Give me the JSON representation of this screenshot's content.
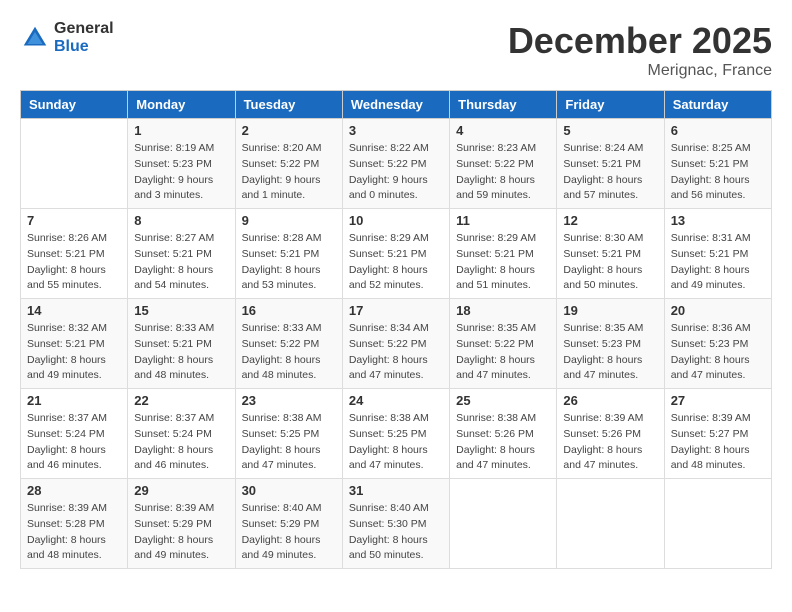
{
  "logo": {
    "general": "General",
    "blue": "Blue"
  },
  "title": "December 2025",
  "location": "Merignac, France",
  "headers": [
    "Sunday",
    "Monday",
    "Tuesday",
    "Wednesday",
    "Thursday",
    "Friday",
    "Saturday"
  ],
  "weeks": [
    [
      {
        "day": "",
        "detail": ""
      },
      {
        "day": "1",
        "detail": "Sunrise: 8:19 AM\nSunset: 5:23 PM\nDaylight: 9 hours\nand 3 minutes."
      },
      {
        "day": "2",
        "detail": "Sunrise: 8:20 AM\nSunset: 5:22 PM\nDaylight: 9 hours\nand 1 minute."
      },
      {
        "day": "3",
        "detail": "Sunrise: 8:22 AM\nSunset: 5:22 PM\nDaylight: 9 hours\nand 0 minutes."
      },
      {
        "day": "4",
        "detail": "Sunrise: 8:23 AM\nSunset: 5:22 PM\nDaylight: 8 hours\nand 59 minutes."
      },
      {
        "day": "5",
        "detail": "Sunrise: 8:24 AM\nSunset: 5:21 PM\nDaylight: 8 hours\nand 57 minutes."
      },
      {
        "day": "6",
        "detail": "Sunrise: 8:25 AM\nSunset: 5:21 PM\nDaylight: 8 hours\nand 56 minutes."
      }
    ],
    [
      {
        "day": "7",
        "detail": "Sunrise: 8:26 AM\nSunset: 5:21 PM\nDaylight: 8 hours\nand 55 minutes."
      },
      {
        "day": "8",
        "detail": "Sunrise: 8:27 AM\nSunset: 5:21 PM\nDaylight: 8 hours\nand 54 minutes."
      },
      {
        "day": "9",
        "detail": "Sunrise: 8:28 AM\nSunset: 5:21 PM\nDaylight: 8 hours\nand 53 minutes."
      },
      {
        "day": "10",
        "detail": "Sunrise: 8:29 AM\nSunset: 5:21 PM\nDaylight: 8 hours\nand 52 minutes."
      },
      {
        "day": "11",
        "detail": "Sunrise: 8:29 AM\nSunset: 5:21 PM\nDaylight: 8 hours\nand 51 minutes."
      },
      {
        "day": "12",
        "detail": "Sunrise: 8:30 AM\nSunset: 5:21 PM\nDaylight: 8 hours\nand 50 minutes."
      },
      {
        "day": "13",
        "detail": "Sunrise: 8:31 AM\nSunset: 5:21 PM\nDaylight: 8 hours\nand 49 minutes."
      }
    ],
    [
      {
        "day": "14",
        "detail": "Sunrise: 8:32 AM\nSunset: 5:21 PM\nDaylight: 8 hours\nand 49 minutes."
      },
      {
        "day": "15",
        "detail": "Sunrise: 8:33 AM\nSunset: 5:21 PM\nDaylight: 8 hours\nand 48 minutes."
      },
      {
        "day": "16",
        "detail": "Sunrise: 8:33 AM\nSunset: 5:22 PM\nDaylight: 8 hours\nand 48 minutes."
      },
      {
        "day": "17",
        "detail": "Sunrise: 8:34 AM\nSunset: 5:22 PM\nDaylight: 8 hours\nand 47 minutes."
      },
      {
        "day": "18",
        "detail": "Sunrise: 8:35 AM\nSunset: 5:22 PM\nDaylight: 8 hours\nand 47 minutes."
      },
      {
        "day": "19",
        "detail": "Sunrise: 8:35 AM\nSunset: 5:23 PM\nDaylight: 8 hours\nand 47 minutes."
      },
      {
        "day": "20",
        "detail": "Sunrise: 8:36 AM\nSunset: 5:23 PM\nDaylight: 8 hours\nand 47 minutes."
      }
    ],
    [
      {
        "day": "21",
        "detail": "Sunrise: 8:37 AM\nSunset: 5:24 PM\nDaylight: 8 hours\nand 46 minutes."
      },
      {
        "day": "22",
        "detail": "Sunrise: 8:37 AM\nSunset: 5:24 PM\nDaylight: 8 hours\nand 46 minutes."
      },
      {
        "day": "23",
        "detail": "Sunrise: 8:38 AM\nSunset: 5:25 PM\nDaylight: 8 hours\nand 47 minutes."
      },
      {
        "day": "24",
        "detail": "Sunrise: 8:38 AM\nSunset: 5:25 PM\nDaylight: 8 hours\nand 47 minutes."
      },
      {
        "day": "25",
        "detail": "Sunrise: 8:38 AM\nSunset: 5:26 PM\nDaylight: 8 hours\nand 47 minutes."
      },
      {
        "day": "26",
        "detail": "Sunrise: 8:39 AM\nSunset: 5:26 PM\nDaylight: 8 hours\nand 47 minutes."
      },
      {
        "day": "27",
        "detail": "Sunrise: 8:39 AM\nSunset: 5:27 PM\nDaylight: 8 hours\nand 48 minutes."
      }
    ],
    [
      {
        "day": "28",
        "detail": "Sunrise: 8:39 AM\nSunset: 5:28 PM\nDaylight: 8 hours\nand 48 minutes."
      },
      {
        "day": "29",
        "detail": "Sunrise: 8:39 AM\nSunset: 5:29 PM\nDaylight: 8 hours\nand 49 minutes."
      },
      {
        "day": "30",
        "detail": "Sunrise: 8:40 AM\nSunset: 5:29 PM\nDaylight: 8 hours\nand 49 minutes."
      },
      {
        "day": "31",
        "detail": "Sunrise: 8:40 AM\nSunset: 5:30 PM\nDaylight: 8 hours\nand 50 minutes."
      },
      {
        "day": "",
        "detail": ""
      },
      {
        "day": "",
        "detail": ""
      },
      {
        "day": "",
        "detail": ""
      }
    ]
  ]
}
